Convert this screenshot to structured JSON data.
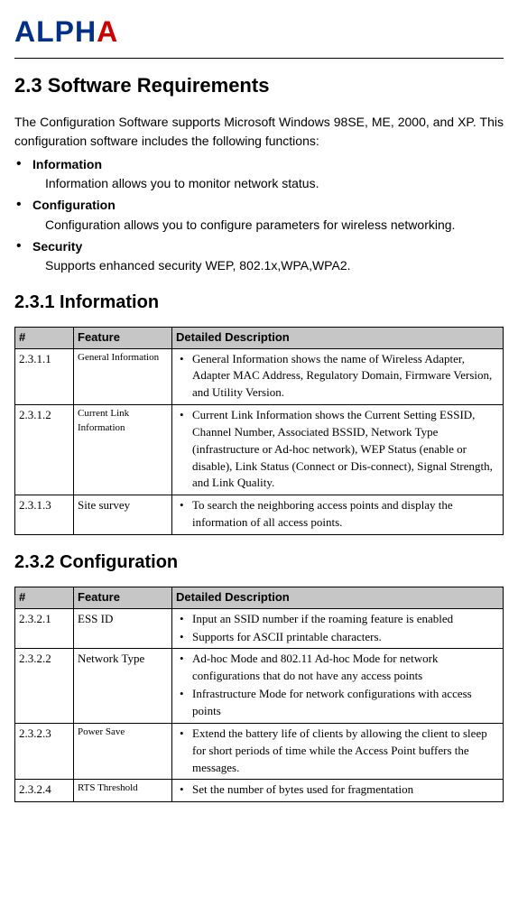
{
  "logo": {
    "text": "ALPHA"
  },
  "section": {
    "title": "2.3 Software Requirements"
  },
  "intro": "The Configuration Software supports Microsoft Windows 98SE, ME, 2000, and XP. This configuration software includes the following functions:",
  "bullets": [
    {
      "title": "Information",
      "desc": "Information allows you to monitor network status."
    },
    {
      "title": "Configuration",
      "desc": "Configuration allows you to configure parameters for wireless networking."
    },
    {
      "title": "Security",
      "desc": "Supports enhanced security WEP, 802.1x,WPA,WPA2."
    }
  ],
  "sub1": {
    "title": "2.3.1 Information"
  },
  "table_headers": {
    "num": "#",
    "feature": "Feature",
    "desc": "Detailed Description"
  },
  "table1": [
    {
      "num": "2.3.1.1",
      "feature": "General Information",
      "feature_small": true,
      "desc_items": [
        "General Information shows the name of Wireless Adapter, Adapter MAC Address, Regulatory Domain, Firmware Version, and Utility Version."
      ]
    },
    {
      "num": "2.3.1.2",
      "feature": "Current Link Information",
      "feature_small": true,
      "desc_items": [
        "Current Link Information shows the Current Setting ESSID, Channel Number, Associated BSSID, Network Type (infrastructure or Ad-hoc network), WEP Status (enable or disable), Link Status (Connect or Dis-connect), Signal Strength, and Link Quality."
      ]
    },
    {
      "num": "2.3.1.3",
      "feature": "Site survey",
      "feature_small": false,
      "desc_items": [
        "To search the neighboring access points and display the information of all access points."
      ]
    }
  ],
  "sub2": {
    "title": "2.3.2 Configuration"
  },
  "table2": [
    {
      "num": "2.3.2.1",
      "feature": "ESS ID",
      "feature_small": false,
      "desc_items": [
        "Input an SSID number if the roaming feature is enabled",
        "Supports for ASCII printable characters."
      ]
    },
    {
      "num": "2.3.2.2",
      "feature": "Network Type",
      "feature_small": false,
      "desc_items": [
        "Ad-hoc Mode and 802.11 Ad-hoc Mode for network configurations that do not have any access points",
        "Infrastructure Mode for network configurations with access points"
      ]
    },
    {
      "num": "2.3.2.3",
      "feature": "Power Save",
      "feature_small": true,
      "desc_items": [
        "Extend the battery life of clients by allowing the client to sleep for short periods of time while the Access Point buffers the messages."
      ]
    },
    {
      "num": "2.3.2.4",
      "feature": "RTS Threshold",
      "feature_small": true,
      "desc_items": [
        "Set the number of bytes used for fragmentation"
      ]
    }
  ]
}
